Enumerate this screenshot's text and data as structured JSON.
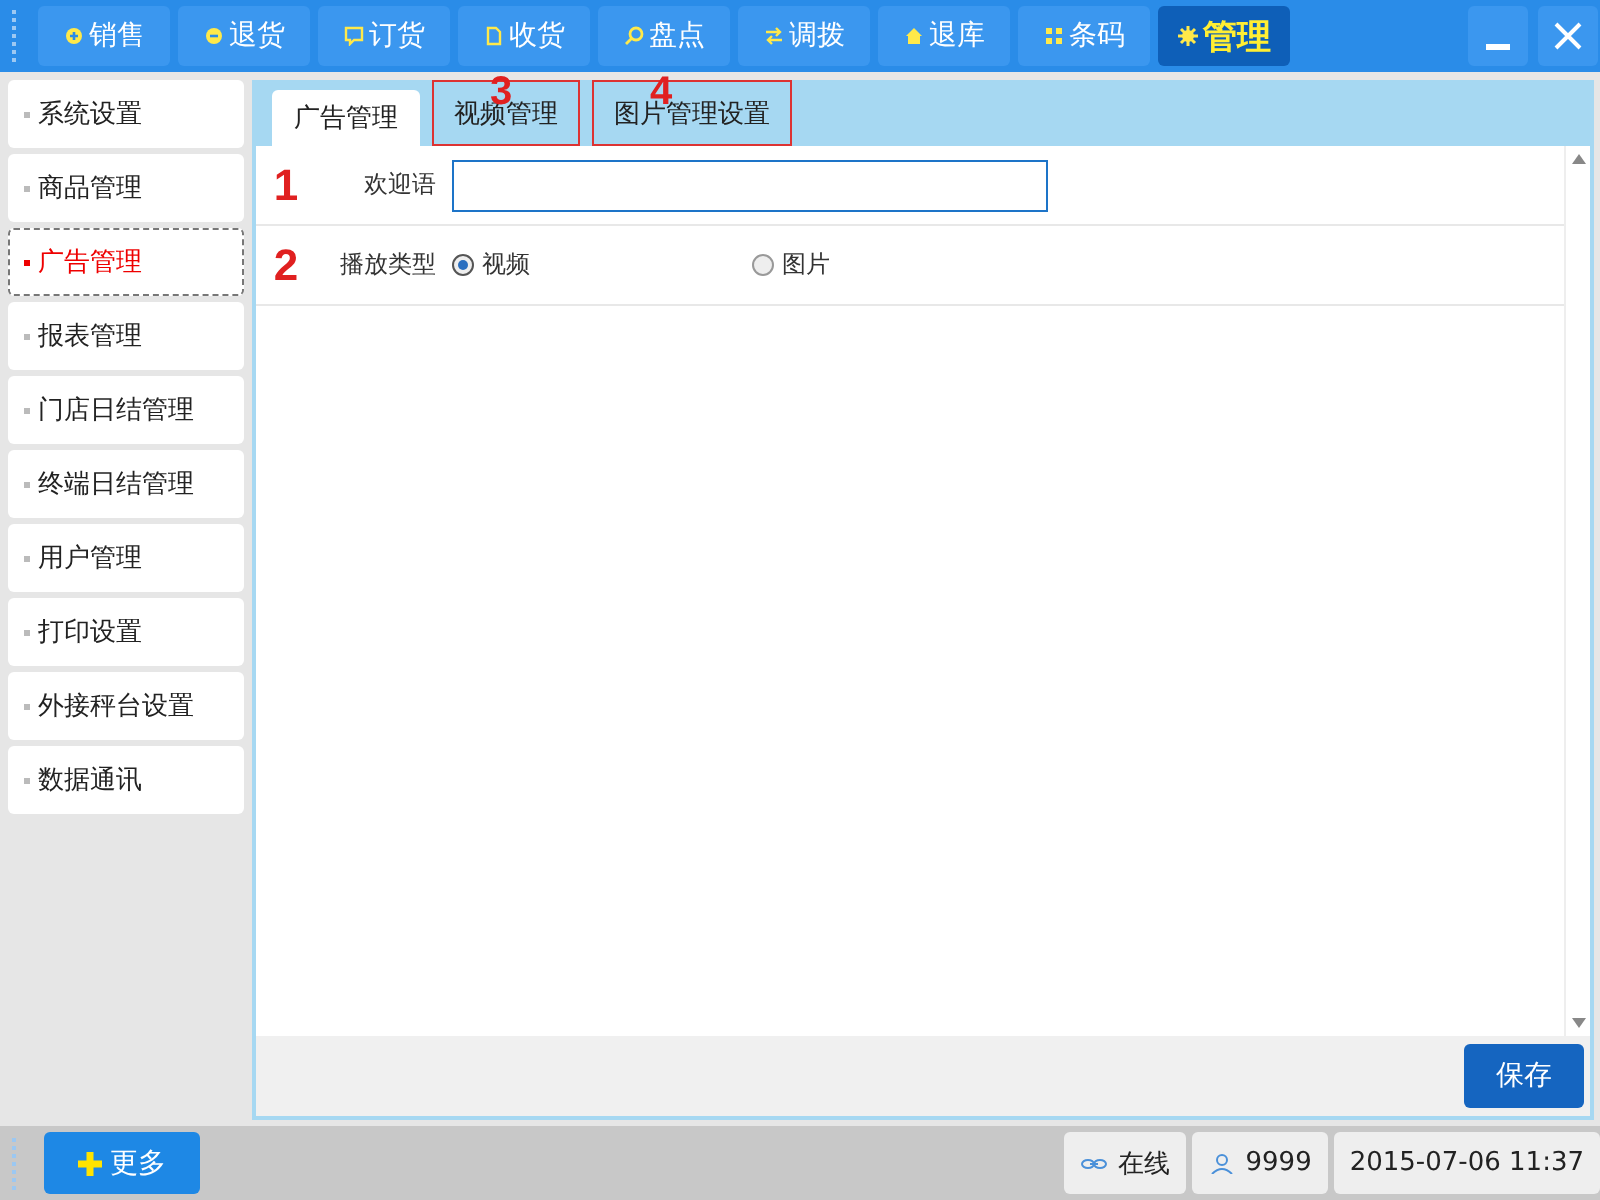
{
  "top_nav": [
    {
      "label": "销售",
      "selected": false
    },
    {
      "label": "退货",
      "selected": false
    },
    {
      "label": "订货",
      "selected": false
    },
    {
      "label": "收货",
      "selected": false
    },
    {
      "label": "盘点",
      "selected": false
    },
    {
      "label": "调拨",
      "selected": false
    },
    {
      "label": "退库",
      "selected": false
    },
    {
      "label": "条码",
      "selected": false
    },
    {
      "label": "管理",
      "selected": true
    }
  ],
  "sidebar": {
    "items": [
      {
        "label": "系统设置",
        "selected": false
      },
      {
        "label": "商品管理",
        "selected": false
      },
      {
        "label": "广告管理",
        "selected": true
      },
      {
        "label": "报表管理",
        "selected": false
      },
      {
        "label": "门店日结管理",
        "selected": false
      },
      {
        "label": "终端日结管理",
        "selected": false
      },
      {
        "label": "用户管理",
        "selected": false
      },
      {
        "label": "打印设置",
        "selected": false
      },
      {
        "label": "外接秤台设置",
        "selected": false
      },
      {
        "label": "数据通讯",
        "selected": false
      }
    ]
  },
  "tabs": [
    {
      "label": "广告管理",
      "selected": true,
      "marked": false
    },
    {
      "label": "视频管理",
      "selected": false,
      "marked": true,
      "annotation": "3"
    },
    {
      "label": "图片管理设置",
      "selected": false,
      "marked": true,
      "annotation": "4"
    }
  ],
  "form": {
    "rows": [
      {
        "kind": "text",
        "annotation": "1",
        "label": "欢迎语",
        "value": ""
      },
      {
        "kind": "radio",
        "annotation": "2",
        "label": "播放类型",
        "options": [
          {
            "label": "视频",
            "selected": true
          },
          {
            "label": "图片",
            "selected": false
          }
        ]
      }
    ]
  },
  "save_button": "保存",
  "bottom_bar": {
    "more_button": "更多",
    "status": "在线",
    "user": "9999",
    "datetime": "2015-07-06 11:37"
  }
}
